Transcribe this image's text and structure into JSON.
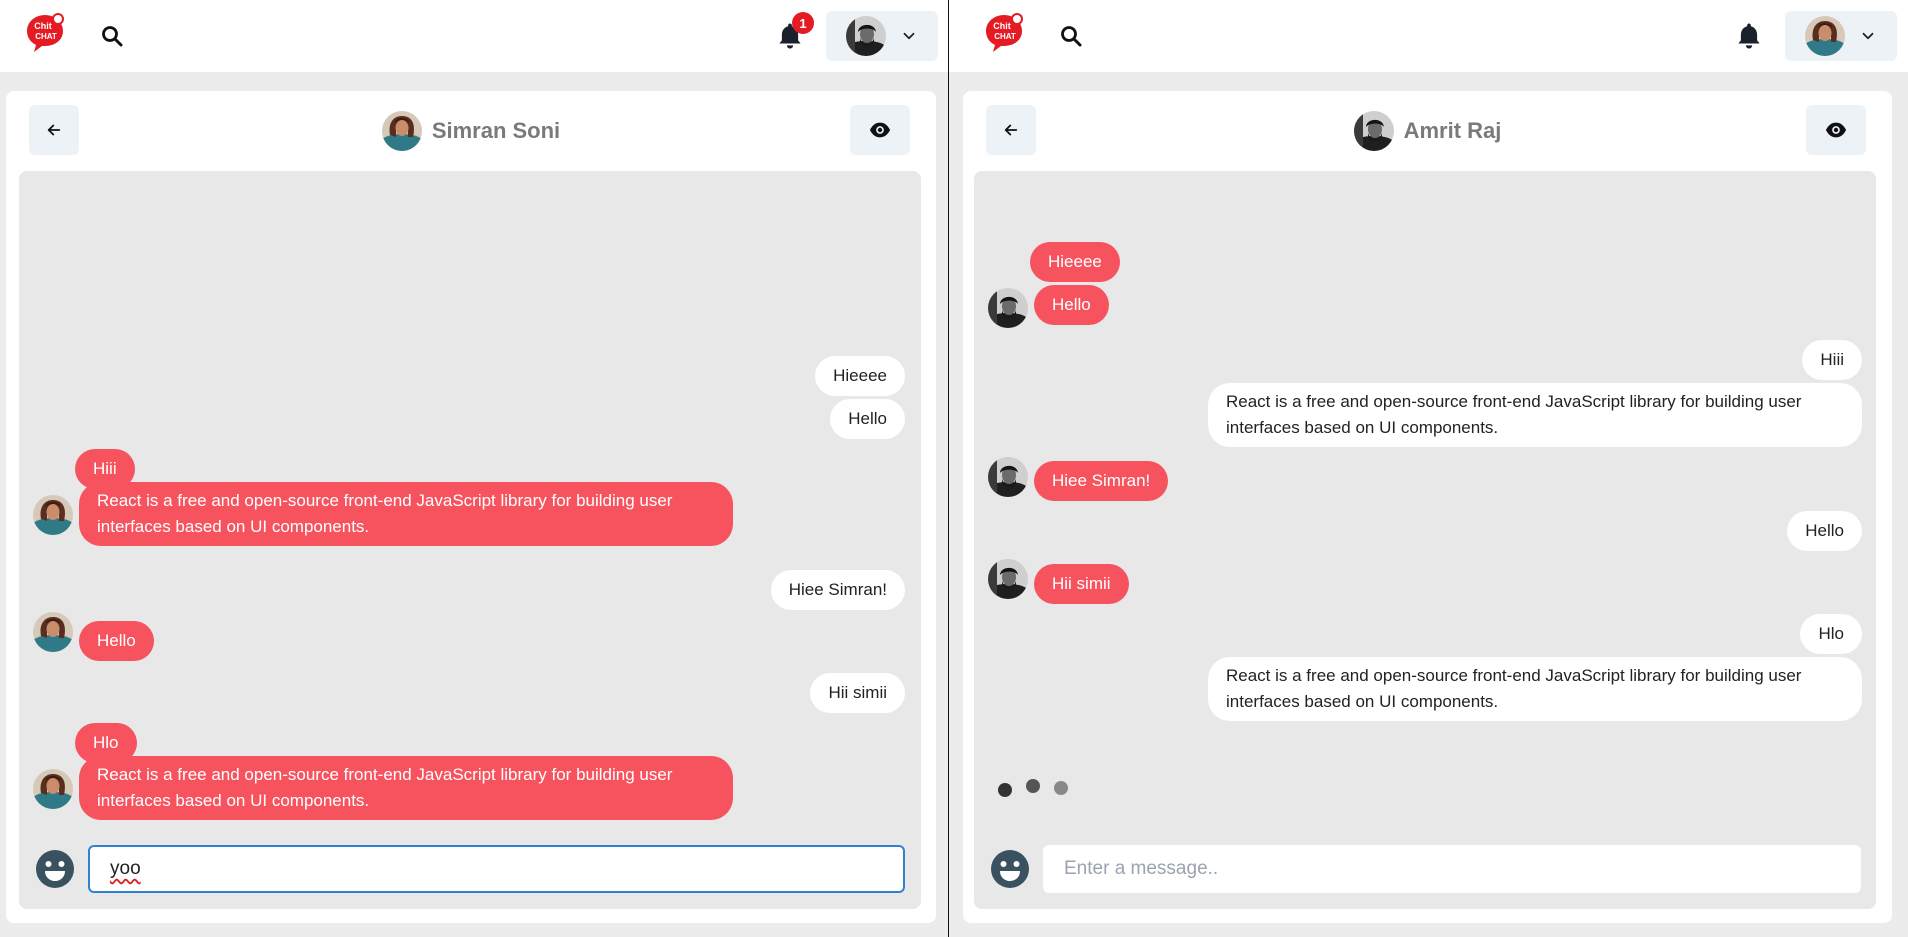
{
  "app": {
    "logo_text_top": "Chit",
    "logo_text_bottom": "CHAT",
    "brand_color": "#e51b23",
    "accent_color": "#f6535f"
  },
  "left": {
    "notification_count": "1",
    "chat_name": "Simran Soni",
    "input_value": "yoo",
    "input_placeholder": "Enter a message..",
    "messages": [
      {
        "text": "Hieeee",
        "side": "right"
      },
      {
        "text": "Hello",
        "side": "right"
      },
      {
        "text": "Hiii",
        "side": "left"
      },
      {
        "text": "React is a free and open-source front-end JavaScript library for building user interfaces based on UI components.",
        "side": "left"
      },
      {
        "text": "Hiee Simran!",
        "side": "right"
      },
      {
        "text": "Hello",
        "side": "left"
      },
      {
        "text": "Hii simii",
        "side": "right"
      },
      {
        "text": "Hlo",
        "side": "left"
      },
      {
        "text": "React is a free and open-source front-end JavaScript library for building user interfaces based on UI components.",
        "side": "left"
      }
    ]
  },
  "right": {
    "chat_name": "Amrit Raj",
    "input_value": "",
    "input_placeholder": "Enter a message..",
    "typing_indicator": true,
    "messages": [
      {
        "text": "Hieeee",
        "side": "left"
      },
      {
        "text": "Hello",
        "side": "left"
      },
      {
        "text": "Hiii",
        "side": "right"
      },
      {
        "text": "React is a free and open-source front-end JavaScript library for building user interfaces based on UI components.",
        "side": "right"
      },
      {
        "text": "Hiee Simran!",
        "side": "left"
      },
      {
        "text": "Hello",
        "side": "right"
      },
      {
        "text": "Hii simii",
        "side": "left"
      },
      {
        "text": "Hlo",
        "side": "right"
      },
      {
        "text": "React is a free and open-source front-end JavaScript library for building user interfaces based on UI components.",
        "side": "right"
      }
    ]
  }
}
